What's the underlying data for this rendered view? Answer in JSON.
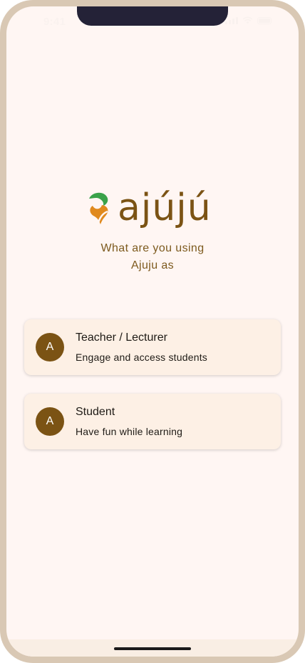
{
  "status_bar": {
    "time": "9:41"
  },
  "logo": {
    "wordmark": "ajújú",
    "colors": {
      "green": "#3aa24a",
      "orange": "#e08a1e",
      "brown": "#7b5314"
    }
  },
  "prompt": {
    "line1": "What are you using",
    "line2": "Ajuju as"
  },
  "options": [
    {
      "avatar": "A",
      "title": "Teacher / Lecturer",
      "description": "Engage and access students"
    },
    {
      "avatar": "A",
      "title": "Student",
      "description": "Have fun while learning"
    }
  ],
  "colors": {
    "background": "#fff6f3",
    "card": "#fdf0e5",
    "accent": "#7b5314",
    "frame": "#d9c8b4"
  }
}
